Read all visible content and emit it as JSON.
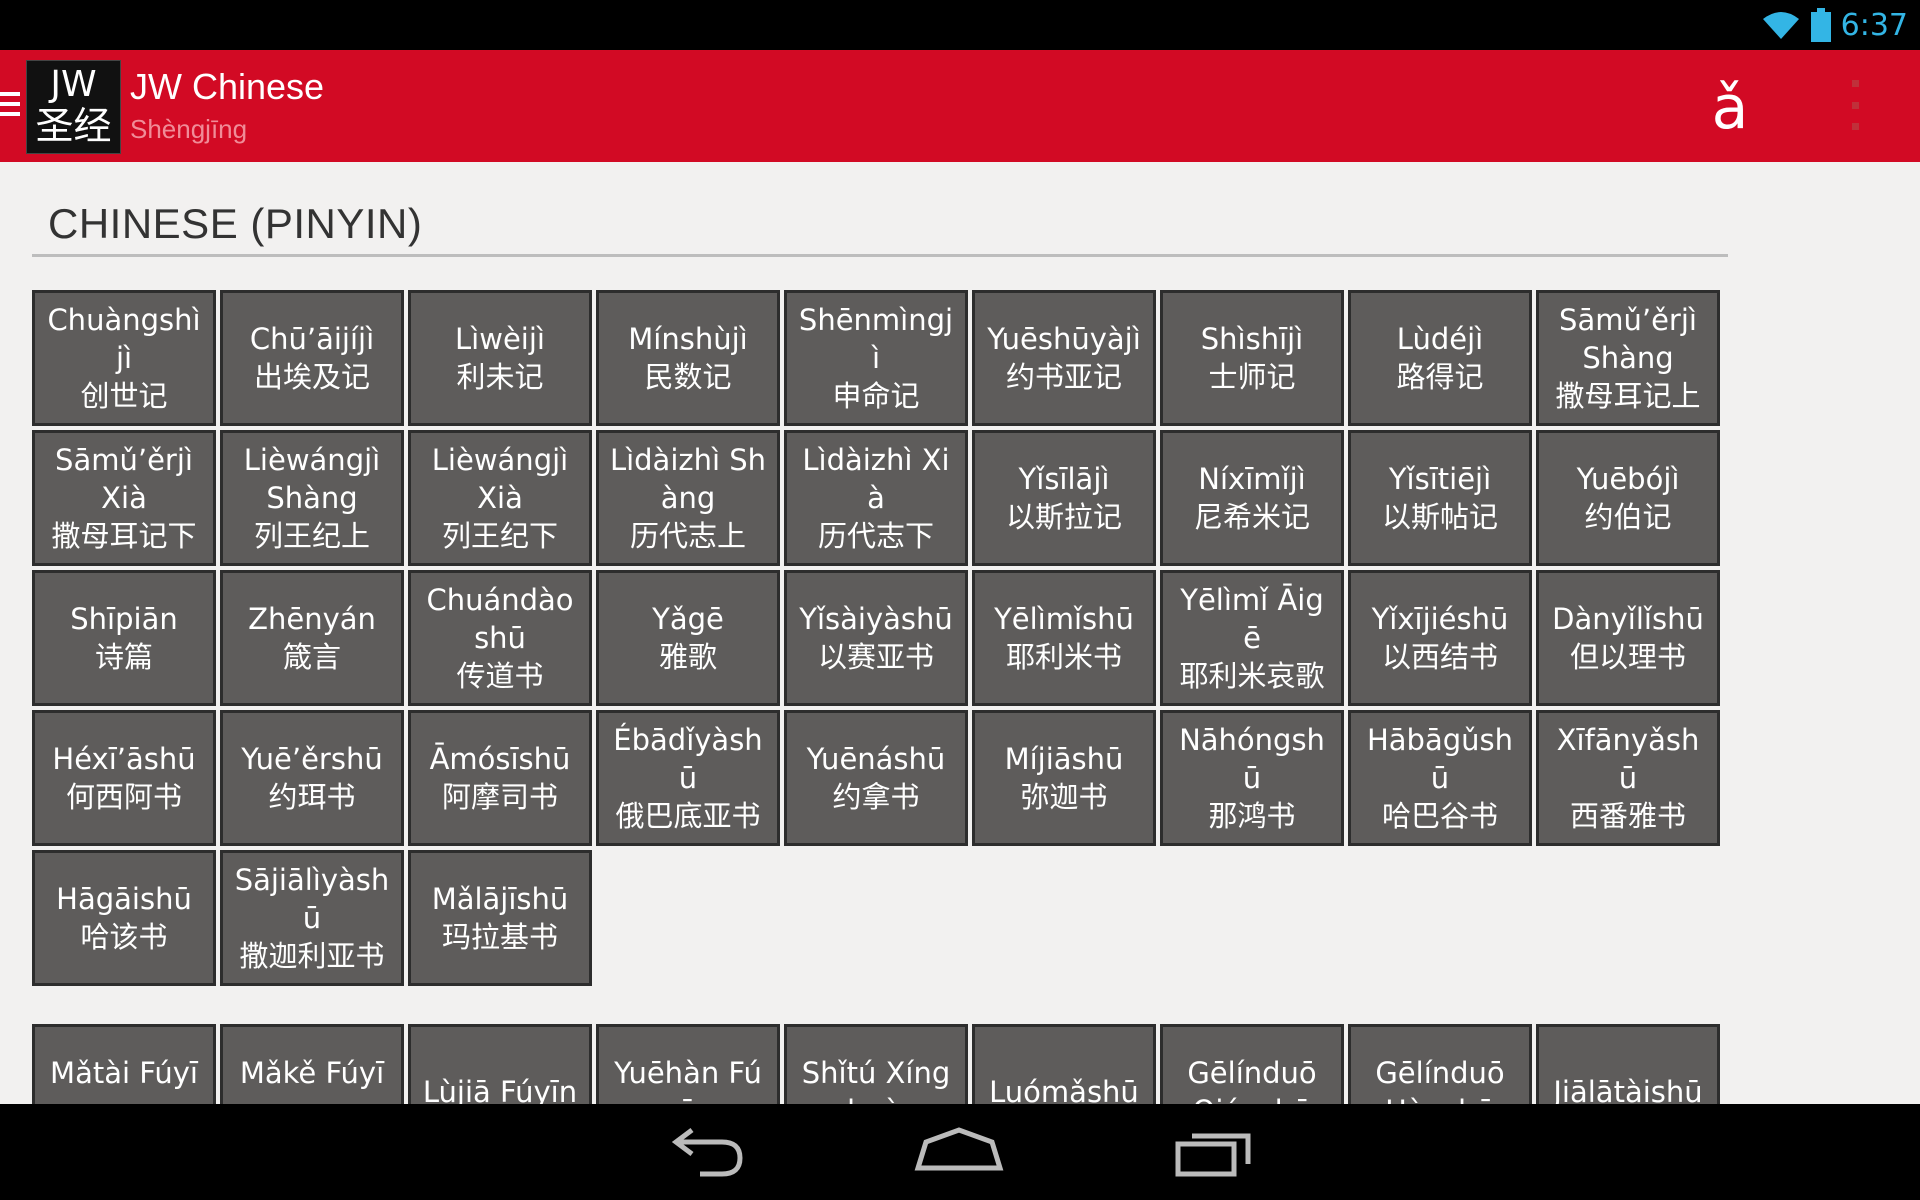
{
  "status_bar": {
    "time": "6:37",
    "icons": [
      "wifi-icon",
      "battery-icon"
    ]
  },
  "action_bar": {
    "logo_line1": "JW",
    "logo_line2": "圣经",
    "title": "JW Chinese",
    "subtitle": "Shèngjīng",
    "pinyin_toggle": "ǎ",
    "icons": [
      "drawer-icon",
      "overflow-menu-icon"
    ]
  },
  "section": {
    "title": "CHINESE (PINYIN)"
  },
  "old_testament": [
    {
      "pinyin": "Chuàngshìjì",
      "hanzi": "创世记"
    },
    {
      "pinyin": "Chū’āijíjì",
      "hanzi": "出埃及记"
    },
    {
      "pinyin": "Lìwèijì",
      "hanzi": "利未记"
    },
    {
      "pinyin": "Mínshùjì",
      "hanzi": "民数记"
    },
    {
      "pinyin": "Shēnmìngjì",
      "hanzi": "申命记"
    },
    {
      "pinyin": "Yuēshūyàjì",
      "hanzi": "约书亚记"
    },
    {
      "pinyin": "Shìshījì",
      "hanzi": "士师记"
    },
    {
      "pinyin": "Lùdéjì",
      "hanzi": "路得记"
    },
    {
      "pinyin": "Sāmǔ’ěrjì Shàng",
      "hanzi": "撒母耳记上"
    },
    {
      "pinyin": "Sāmǔ’ěrjì Xià",
      "hanzi": "撒母耳记下"
    },
    {
      "pinyin": "Lièwángjì Shàng",
      "hanzi": "列王纪上"
    },
    {
      "pinyin": "Lièwángjì Xià",
      "hanzi": "列王纪下"
    },
    {
      "pinyin": "Lìdàizhì Shàng",
      "hanzi": "历代志上"
    },
    {
      "pinyin": "Lìdàizhì Xià",
      "hanzi": "历代志下"
    },
    {
      "pinyin": "Yǐsīlājì",
      "hanzi": "以斯拉记"
    },
    {
      "pinyin": "Níxīmǐjì",
      "hanzi": "尼希米记"
    },
    {
      "pinyin": "Yǐsītiējì",
      "hanzi": "以斯帖记"
    },
    {
      "pinyin": "Yuēbójì",
      "hanzi": "约伯记"
    },
    {
      "pinyin": "Shīpiān",
      "hanzi": "诗篇"
    },
    {
      "pinyin": "Zhēnyán",
      "hanzi": "箴言"
    },
    {
      "pinyin": "Chuándàoshū",
      "hanzi": "传道书"
    },
    {
      "pinyin": "Yǎgē",
      "hanzi": "雅歌"
    },
    {
      "pinyin": "Yǐsàiyàshū",
      "hanzi": "以赛亚书"
    },
    {
      "pinyin": "Yēlìmǐshū",
      "hanzi": "耶利米书"
    },
    {
      "pinyin": "Yēlìmǐ Āigē",
      "hanzi": "耶利米哀歌"
    },
    {
      "pinyin": "Yǐxījiéshū",
      "hanzi": "以西结书"
    },
    {
      "pinyin": "Dànyǐlǐshū",
      "hanzi": "但以理书"
    },
    {
      "pinyin": "Héxī’āshū",
      "hanzi": "何西阿书"
    },
    {
      "pinyin": "Yuē’ěrshū",
      "hanzi": "约珥书"
    },
    {
      "pinyin": "Āmósīshū",
      "hanzi": "阿摩司书"
    },
    {
      "pinyin": "Ébādǐyàshū",
      "hanzi": "俄巴底亚书"
    },
    {
      "pinyin": "Yuēnáshū",
      "hanzi": "约拿书"
    },
    {
      "pinyin": "Míjiāshū",
      "hanzi": "弥迦书"
    },
    {
      "pinyin": "Nāhóngshū",
      "hanzi": "那鸿书"
    },
    {
      "pinyin": "Hābāgǔshū",
      "hanzi": "哈巴谷书"
    },
    {
      "pinyin": "Xīfānyǎshū",
      "hanzi": "西番雅书"
    },
    {
      "pinyin": "Hāgāishū",
      "hanzi": "哈该书"
    },
    {
      "pinyin": "Sājiālìyàshū",
      "hanzi": "撒迦利亚书"
    },
    {
      "pinyin": "Mǎlājīshū",
      "hanzi": "玛拉基书"
    }
  ],
  "new_testament": [
    {
      "pinyin": "Mǎtài Fúyīn",
      "hanzi": ""
    },
    {
      "pinyin": "Mǎkě Fúyīn",
      "hanzi": ""
    },
    {
      "pinyin": "Lùjiā Fúyīn",
      "hanzi": ""
    },
    {
      "pinyin": "Yuēhàn Fúyīn",
      "hanzi": ""
    },
    {
      "pinyin": "Shǐtú Xíngzhuàn",
      "hanzi": ""
    },
    {
      "pinyin": "Luómǎshū",
      "hanzi": ""
    },
    {
      "pinyin": "Gēlínduō Qiánshū",
      "hanzi": ""
    },
    {
      "pinyin": "Gēlínduō Hòushū",
      "hanzi": ""
    },
    {
      "pinyin": "Jiālātàishū",
      "hanzi": ""
    }
  ],
  "nav_bar": {
    "icons": [
      "back-icon",
      "home-icon",
      "recents-icon"
    ]
  }
}
